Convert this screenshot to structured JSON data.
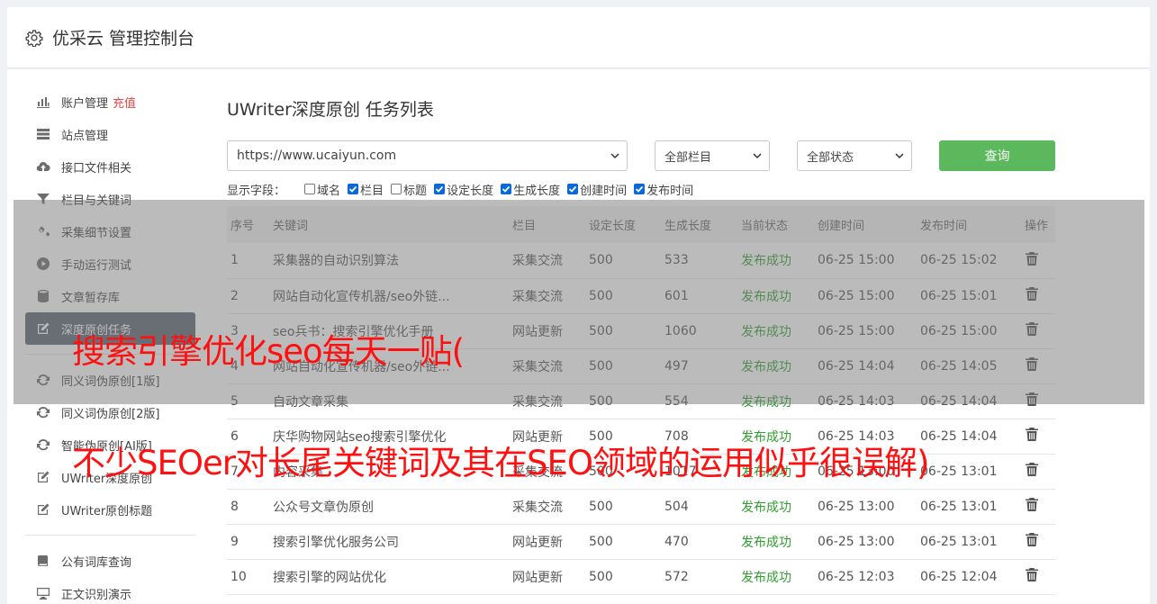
{
  "header": {
    "title": "优采云 管理控制台"
  },
  "sidebar": {
    "groups": [
      [
        {
          "label": "账户管理",
          "extra": "充值",
          "icon": "bar-chart-icon"
        },
        {
          "label": "站点管理",
          "icon": "server-icon"
        },
        {
          "label": "接口文件相关",
          "icon": "cloud-upload-icon"
        },
        {
          "label": "栏目与关键词",
          "icon": "filter-icon"
        },
        {
          "label": "采集细节设置",
          "icon": "gears-icon"
        },
        {
          "label": "手动运行测试",
          "icon": "play-circle-icon"
        },
        {
          "label": "文章暂存库",
          "icon": "database-icon"
        },
        {
          "label": "深度原创任务",
          "icon": "edit-icon",
          "active": true
        }
      ],
      [
        {
          "label": "同义词伪原创[1版]",
          "icon": "refresh-icon"
        },
        {
          "label": "同义词伪原创[2版]",
          "icon": "refresh-icon"
        },
        {
          "label": "智能伪原创[AI版]",
          "icon": "refresh-icon"
        },
        {
          "label": "UWriter深度原创",
          "icon": "edit-icon"
        },
        {
          "label": "UWriter原创标题",
          "icon": "edit-icon"
        }
      ],
      [
        {
          "label": "公有词库查询",
          "icon": "book-icon"
        },
        {
          "label": "正文识别演示",
          "icon": "monitor-icon"
        }
      ]
    ]
  },
  "main": {
    "title": "UWriter深度原创 任务列表",
    "site_select": "https://www.ucaiyun.com",
    "column_select": "全部栏目",
    "status_select": "全部状态",
    "query_label": "查询",
    "fields_label": "显示字段：",
    "fields": [
      {
        "label": "域名",
        "checked": false
      },
      {
        "label": "栏目",
        "checked": true
      },
      {
        "label": "标题",
        "checked": false
      },
      {
        "label": "设定长度",
        "checked": true
      },
      {
        "label": "生成长度",
        "checked": true
      },
      {
        "label": "创建时间",
        "checked": true
      },
      {
        "label": "发布时间",
        "checked": true
      }
    ],
    "columns": [
      "序号",
      "关键词",
      "栏目",
      "设定长度",
      "生成长度",
      "当前状态",
      "创建时间",
      "发布时间",
      "操作"
    ],
    "rows": [
      [
        "1",
        "采集器的自动识别算法",
        "采集交流",
        "500",
        "533",
        "发布成功",
        "06-25 15:00",
        "06-25 15:02"
      ],
      [
        "2",
        "网站自动化宣传机器/seo外链...",
        "采集交流",
        "500",
        "601",
        "发布成功",
        "06-25 15:00",
        "06-25 15:01"
      ],
      [
        "3",
        "seo兵书：搜索引擎优化手册",
        "网站更新",
        "500",
        "1060",
        "发布成功",
        "06-25 15:00",
        "06-25 15:00"
      ],
      [
        "4",
        "网站自动化宣传机器/seo外链...",
        "采集交流",
        "500",
        "497",
        "发布成功",
        "06-25 14:04",
        "06-25 14:05"
      ],
      [
        "5",
        "自动文章采集",
        "采集交流",
        "500",
        "554",
        "发布成功",
        "06-25 14:03",
        "06-25 14:04"
      ],
      [
        "6",
        "庆华购物网站seo搜索引擎优化",
        "网站更新",
        "500",
        "708",
        "发布成功",
        "06-25 14:03",
        "06-25 14:04"
      ],
      [
        "7",
        "内容采集",
        "采集交流",
        "500",
        "1017",
        "发布成功",
        "06-25 13:00",
        "06-25 13:01"
      ],
      [
        "8",
        "公众号文章伪原创",
        "采集交流",
        "500",
        "504",
        "发布成功",
        "06-25 13:00",
        "06-25 13:01"
      ],
      [
        "9",
        "搜索引擎优化服务公司",
        "网站更新",
        "500",
        "470",
        "发布成功",
        "06-25 13:00",
        "06-25 13:01"
      ],
      [
        "10",
        "搜索引擎的网站优化",
        "网站更新",
        "500",
        "572",
        "发布成功",
        "06-25 12:03",
        "06-25 12:04"
      ]
    ]
  },
  "overlay": {
    "line1": "搜索引擎优化seo每天一贴(",
    "line2": "不少SEOer对长尾关键词及其在SEO领域的运用似乎很误解)"
  },
  "colors": {
    "accent_green": "#5cb85c",
    "status_green": "#2e9e2e",
    "recharge_red": "#e64545",
    "active_nav": "#5b6573",
    "caption_red": "#ff1010"
  }
}
